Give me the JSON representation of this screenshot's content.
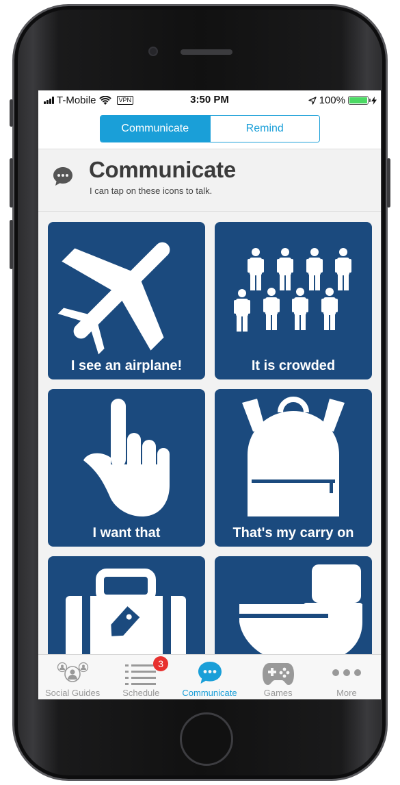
{
  "status_bar": {
    "carrier": "T-Mobile",
    "vpn": "VPN",
    "time": "3:50 PM",
    "battery": "100%",
    "battery_level": 1.0
  },
  "segment": {
    "communicate_label": "Communicate",
    "remind_label": "Remind",
    "active": "Communicate"
  },
  "header": {
    "title": "Communicate",
    "subtitle": "I can tap on these icons to talk."
  },
  "tiles": [
    {
      "label": "I see an airplane!",
      "icon": "airplane-icon"
    },
    {
      "label": "It is crowded",
      "icon": "crowd-icon"
    },
    {
      "label": "I want that",
      "icon": "pointing-hand-icon"
    },
    {
      "label": "That's my carry on",
      "icon": "backpack-icon"
    },
    {
      "label": "",
      "icon": "suitcase-icon"
    },
    {
      "label": "",
      "icon": "toilet-icon"
    }
  ],
  "tab_bar": {
    "items": [
      {
        "label": "Social Guides",
        "icon": "social-guides-icon"
      },
      {
        "label": "Schedule",
        "icon": "schedule-icon",
        "badge": "3"
      },
      {
        "label": "Communicate",
        "icon": "chat-bubble-icon"
      },
      {
        "label": "Games",
        "icon": "gamepad-icon"
      },
      {
        "label": "More",
        "icon": "more-dots-icon"
      }
    ],
    "active": "Communicate"
  },
  "colors": {
    "accent": "#1a9fd8",
    "tile_background": "#1b4a7e",
    "badge": "#e8312f"
  }
}
